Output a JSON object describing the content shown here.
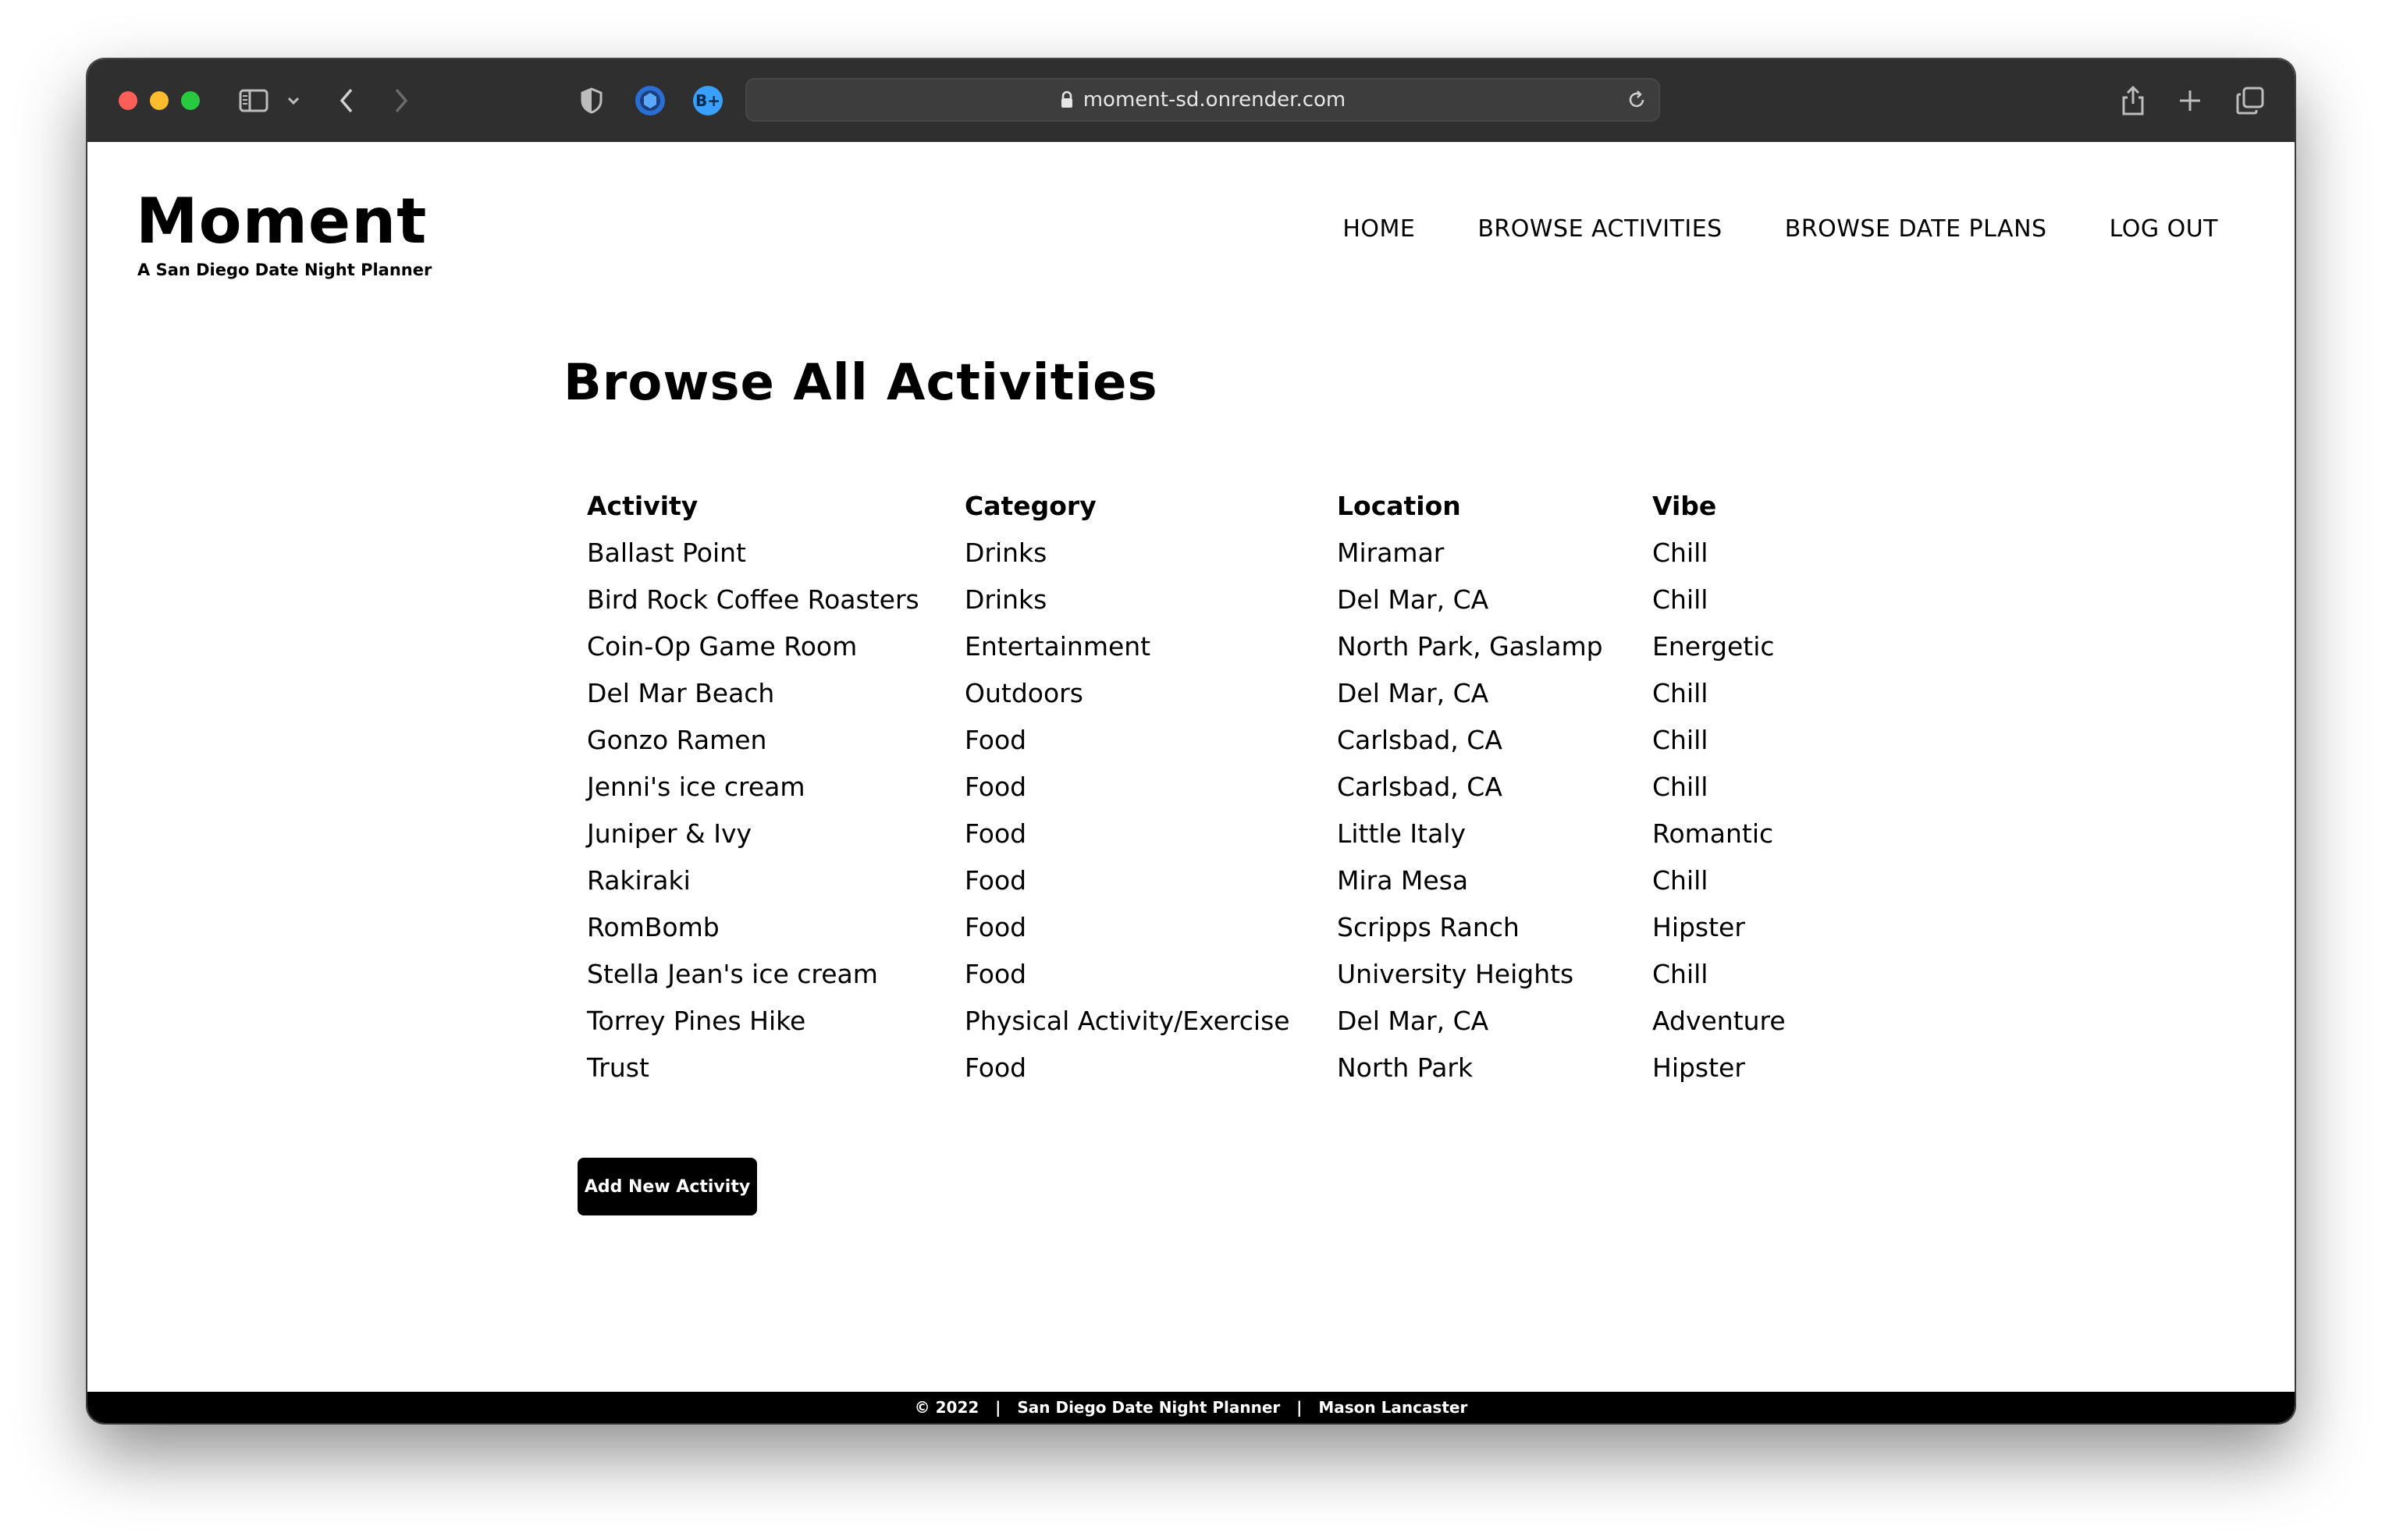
{
  "browser": {
    "url": "moment-sd.onrender.com"
  },
  "brand": {
    "title": "Moment",
    "subtitle": "A San Diego Date Night Planner"
  },
  "nav": {
    "home": "HOME",
    "activities": "BROWSE ACTIVITIES",
    "date_plans": "BROWSE DATE PLANS",
    "logout": "LOG OUT"
  },
  "page": {
    "heading": "Browse All Activities"
  },
  "table": {
    "headers": [
      "Activity",
      "Category",
      "Location",
      "Vibe"
    ],
    "rows": [
      [
        "Ballast Point",
        "Drinks",
        "Miramar",
        "Chill"
      ],
      [
        "Bird Rock Coffee Roasters",
        "Drinks",
        "Del Mar, CA",
        "Chill"
      ],
      [
        "Coin-Op Game Room",
        "Entertainment",
        "North Park, Gaslamp",
        "Energetic"
      ],
      [
        "Del Mar Beach",
        "Outdoors",
        "Del Mar, CA",
        "Chill"
      ],
      [
        "Gonzo Ramen",
        "Food",
        "Carlsbad, CA",
        "Chill"
      ],
      [
        "Jenni's ice cream",
        "Food",
        "Carlsbad, CA",
        "Chill"
      ],
      [
        "Juniper & Ivy",
        "Food",
        "Little Italy",
        "Romantic"
      ],
      [
        "Rakiraki",
        "Food",
        "Mira Mesa",
        "Chill"
      ],
      [
        "RomBomb",
        "Food",
        "Scripps Ranch",
        "Hipster"
      ],
      [
        "Stella Jean's ice cream",
        "Food",
        "University Heights",
        "Chill"
      ],
      [
        "Torrey Pines Hike",
        "Physical Activity/Exercise",
        "Del Mar, CA",
        "Adventure"
      ],
      [
        "Trust",
        "Food",
        "North Park",
        "Hipster"
      ]
    ]
  },
  "add_button_label": "Add New Activity",
  "footer": {
    "text": "© 2022   |   San Diego Date Night Planner   |   Mason Lancaster"
  },
  "colors": {
    "chrome": "#2f2f2f",
    "button": "#000000",
    "footer": "#000000",
    "accent_extension": "#3aa0ff"
  }
}
